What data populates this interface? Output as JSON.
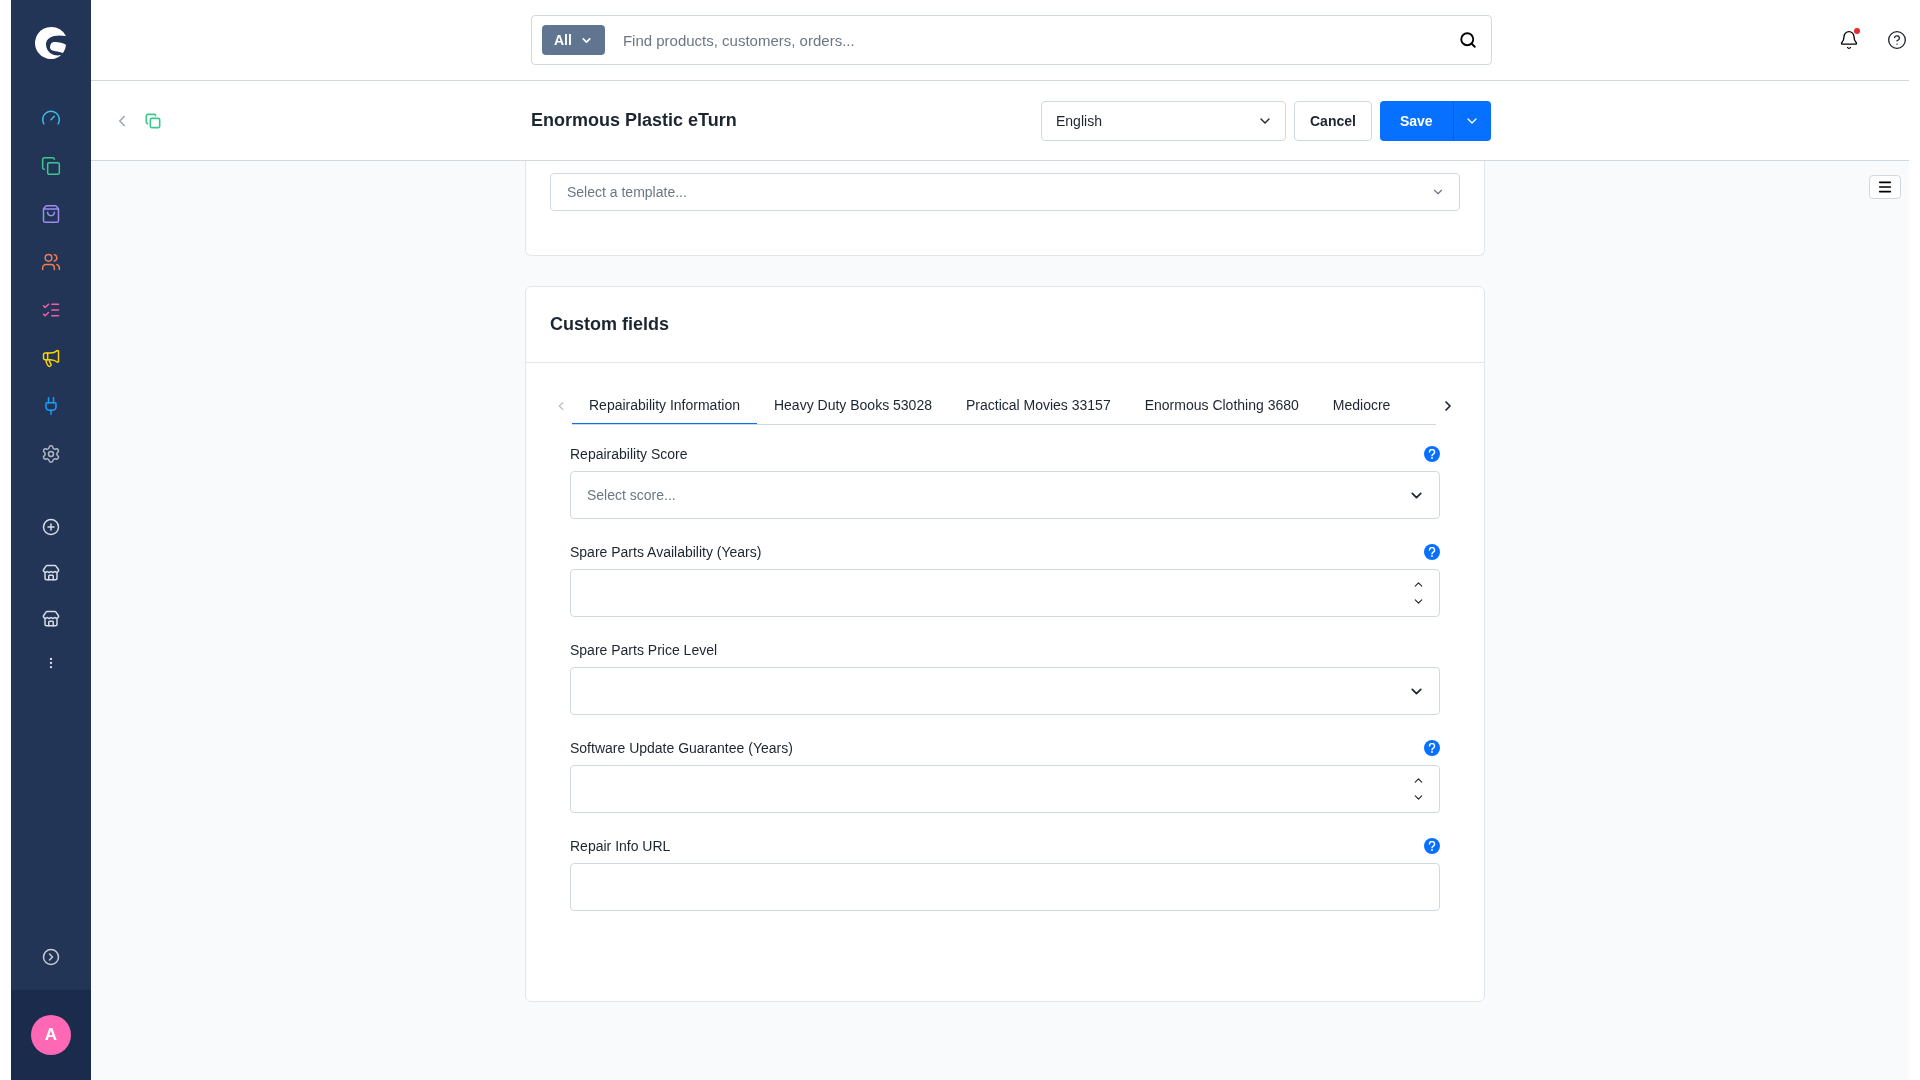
{
  "sidebar": {
    "items": [
      {
        "color": "#3dbde8"
      },
      {
        "color": "#3cc88e"
      },
      {
        "color": "#9d8cf2"
      },
      {
        "color": "#f07e55"
      },
      {
        "color": "#f15fa6"
      },
      {
        "color": "#ffd400"
      },
      {
        "color": "#189eff"
      },
      {
        "color": "#b0b8c4"
      }
    ],
    "user": {
      "initial": "A"
    }
  },
  "search": {
    "scope": "All",
    "placeholder": "Find products, customers, orders..."
  },
  "notifications": {
    "unread": true
  },
  "header": {
    "title": "Enormous Plastic eTurn",
    "language": "English",
    "cancel": "Cancel",
    "save": "Save"
  },
  "template_field": {
    "placeholder": "Select a template..."
  },
  "custom_fields": {
    "title": "Custom fields",
    "tabs": [
      {
        "label": "Repairability Information",
        "selected": true
      },
      {
        "label": "Heavy Duty Books 53028",
        "selected": false
      },
      {
        "label": "Practical Movies 33157",
        "selected": false
      },
      {
        "label": "Enormous Clothing 3680",
        "selected": false
      },
      {
        "label": "Mediocre",
        "selected": false
      }
    ],
    "fields": [
      {
        "kind": "select",
        "label": "Repairability Score",
        "placeholder": "Select score...",
        "help": true
      },
      {
        "kind": "number",
        "label": "Spare Parts Availability (Years)",
        "help": true
      },
      {
        "kind": "select",
        "label": "Spare Parts Price Level",
        "help": false
      },
      {
        "kind": "number",
        "label": "Software Update Guarantee (Years)",
        "help": true
      },
      {
        "kind": "text",
        "label": "Repair Info URL",
        "help": true
      }
    ]
  }
}
